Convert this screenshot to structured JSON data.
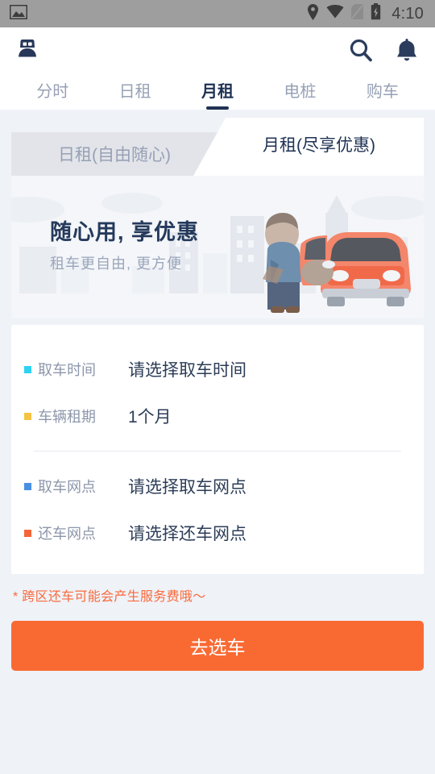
{
  "statusbar": {
    "time": "4:10",
    "icons": [
      "image-icon",
      "location-icon",
      "wifi-icon",
      "no-sim-icon",
      "battery-charging-icon"
    ]
  },
  "appbar": {
    "profile_icon": "user-avatar-icon",
    "search_icon": "search-icon",
    "bell_icon": "notification-bell-icon"
  },
  "tabs": [
    {
      "label": "分时",
      "active": false
    },
    {
      "label": "日租",
      "active": false
    },
    {
      "label": "月租",
      "active": true
    },
    {
      "label": "电桩",
      "active": false
    },
    {
      "label": "购车",
      "active": false
    }
  ],
  "subtabs": [
    {
      "label": "日租(自由随心)",
      "active": false
    },
    {
      "label": "月租(尽享优惠)",
      "active": true
    }
  ],
  "banner": {
    "title": "随心用, 享优惠",
    "subtitle": "租车更自由, 更方便",
    "illustration": "person-opening-car-door-with-city-skyline"
  },
  "form": {
    "rows": [
      {
        "label": "取车时间",
        "value": "请选择取车时间",
        "bullet_color": "#2ed2f2"
      },
      {
        "label": "车辆租期",
        "value": "1个月",
        "bullet_color": "#f5c344"
      },
      {
        "label": "取车网点",
        "value": "请选择取车网点",
        "bullet_color": "#4a90e2"
      },
      {
        "label": "还车网点",
        "value": "请选择还车网点",
        "bullet_color": "#f4663a"
      }
    ]
  },
  "footnote": "* 跨区还车可能会产生服务费哦～",
  "cta": {
    "label": "去选车",
    "color": "#f96a33"
  },
  "colors": {
    "page_bg": "#eff2f7",
    "brand_navy": "#1f3254",
    "accent_orange": "#f96a33",
    "muted_text": "#97a1b5"
  }
}
